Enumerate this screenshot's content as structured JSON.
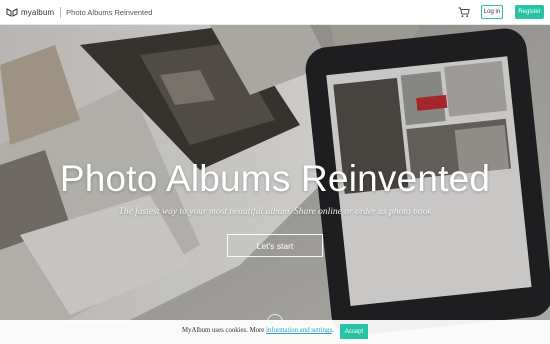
{
  "header": {
    "logo_text": "myalbum",
    "tagline": "Photo Albums Reinvented",
    "cart_icon": "shopping-cart-icon",
    "login_label": "Log in",
    "register_label": "Register"
  },
  "hero": {
    "title": "Photo Albums Reinvented",
    "subtitle": "The fastest way to your most beautiful album. Share online or order as photo book",
    "cta_label": "Let's start",
    "scroll_icon": "scroll-down-icon"
  },
  "cookie": {
    "text": "MyAlbum uses cookies. More ",
    "link_label": "information and settings",
    "link_suffix": ".",
    "accept_label": "Accept"
  },
  "colors": {
    "accent": "#27c3a4",
    "link": "#27a7c3"
  }
}
